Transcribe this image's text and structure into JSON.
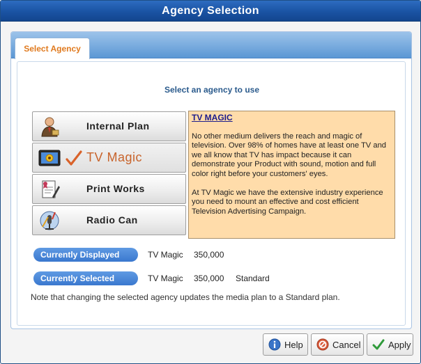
{
  "window": {
    "title": "Agency Selection"
  },
  "tab": {
    "label": "Select Agency"
  },
  "prompt": "Select an agency to use",
  "agencies": [
    {
      "label": "Internal Plan",
      "icon": "person-icon",
      "selected": false
    },
    {
      "label": "TV Magic",
      "icon": "tv-icon",
      "selected": true
    },
    {
      "label": "Print Works",
      "icon": "print-icon",
      "selected": false
    },
    {
      "label": "Radio Can",
      "icon": "radio-icon",
      "selected": false
    }
  ],
  "description": {
    "title": "TV MAGIC",
    "para1": "No other medium delivers the reach and magic of television. Over 98% of homes have at least one TV and we all know that TV has impact because it can demonstrate your Product with sound, motion and full color right before your customers' eyes.",
    "para2": "At TV Magic we have the extensive industry experience you need to mount an effective and cost efficient Television Advertising Campaign."
  },
  "currently_displayed": {
    "label": "Currently Displayed",
    "agency": "TV Magic",
    "amount": "350,000",
    "plan": ""
  },
  "currently_selected": {
    "label": "Currently Selected",
    "agency": "TV Magic",
    "amount": "350,000",
    "plan": "Standard"
  },
  "note": "Note that changing the selected agency updates the media plan to a Standard plan.",
  "buttons": {
    "help": "Help",
    "cancel": "Cancel",
    "apply": "Apply"
  },
  "colors": {
    "title_bar": "#1a53a3",
    "accent_orange": "#e07a1e",
    "pill_blue": "#3a78cf",
    "description_bg": "#ffdcaa"
  }
}
